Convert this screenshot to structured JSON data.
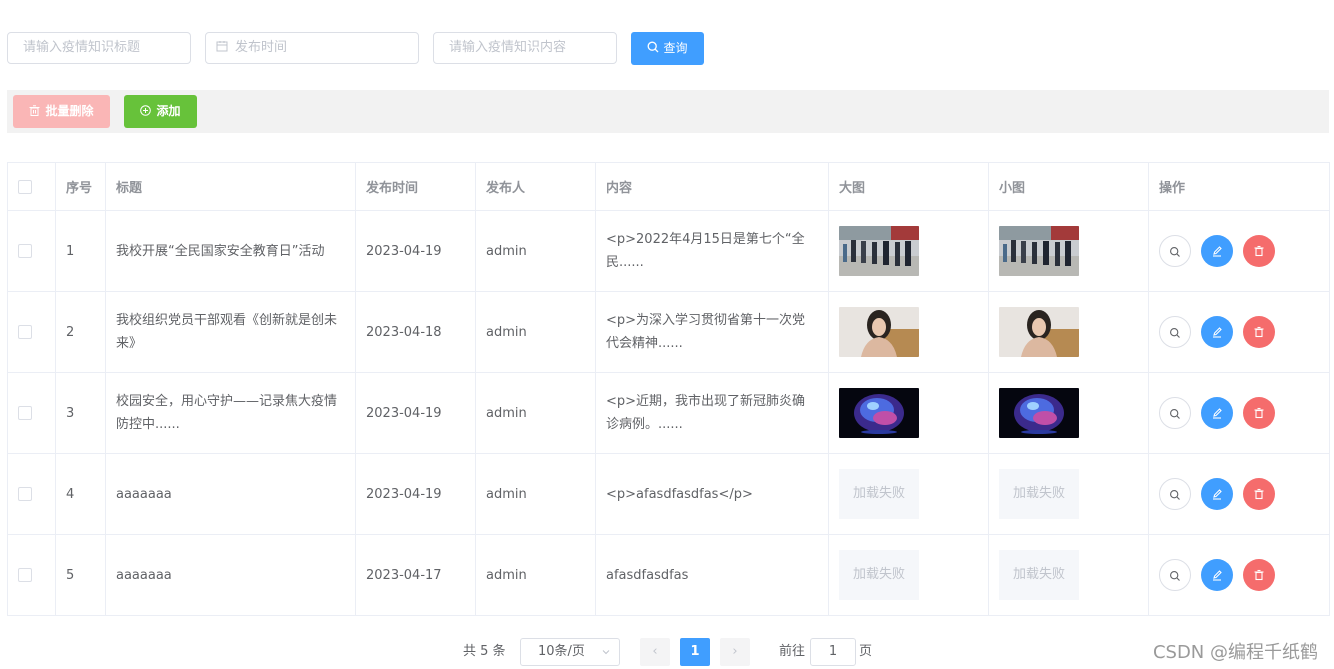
{
  "search": {
    "title_placeholder": "请输入疫情知识标题",
    "date_placeholder": "发布时间",
    "content_placeholder": "请输入疫情知识内容",
    "query_label": "查询"
  },
  "toolbar": {
    "batch_delete_label": "批量删除",
    "add_label": "添加"
  },
  "table": {
    "headers": [
      "序号",
      "标题",
      "发布时间",
      "发布人",
      "内容",
      "大图",
      "小图",
      "操作"
    ],
    "rows": [
      {
        "no": "1",
        "title": "我校开展“全民国家安全教育日”活动",
        "date": "2023-04-19",
        "author": "admin",
        "content": "<p>2022年4月15日是第七个“全民......",
        "big_image": "photo-crowd",
        "small_image": "photo-crowd"
      },
      {
        "no": "2",
        "title": "我校组织党员干部观看《创新就是创未来》",
        "date": "2023-04-18",
        "author": "admin",
        "content": "<p>为深入学习贯彻省第十一次党代会精神......",
        "big_image": "photo-portrait",
        "small_image": "photo-portrait"
      },
      {
        "no": "3",
        "title": "校园安全，用心守护——记录焦大疫情防控中......",
        "date": "2023-04-19",
        "author": "admin",
        "content": "<p>近期，我市出现了新冠肺炎确诊病例。......",
        "big_image": "photo-globe",
        "small_image": "photo-globe"
      },
      {
        "no": "4",
        "title": "aaaaaaa",
        "date": "2023-04-19",
        "author": "admin",
        "content": "<p>afasdfasdfas</p>",
        "big_image": "加载失败",
        "small_image": "加载失败"
      },
      {
        "no": "5",
        "title": "aaaaaaa",
        "date": "2023-04-17",
        "author": "admin",
        "content": "afasdfasdfas",
        "big_image": "加载失败",
        "small_image": "加载失败"
      }
    ]
  },
  "pagination": {
    "total_label": "共 5 条",
    "page_size_label": "10条/页",
    "current_page": "1",
    "goto_label": "前往",
    "goto_value": "1",
    "page_suffix": "页"
  },
  "watermark": "CSDN @编程千纸鹤",
  "colors": {
    "primary": "#409eff",
    "success": "#67c23a",
    "danger": "#f56c6c",
    "danger_light": "#fab6b6"
  },
  "icons": {
    "query": "search-icon",
    "date": "calendar-icon",
    "batch_delete": "trash-icon",
    "add": "plus-circle-icon",
    "view": "search-icon",
    "edit": "edit-icon",
    "delete": "trash-icon"
  }
}
